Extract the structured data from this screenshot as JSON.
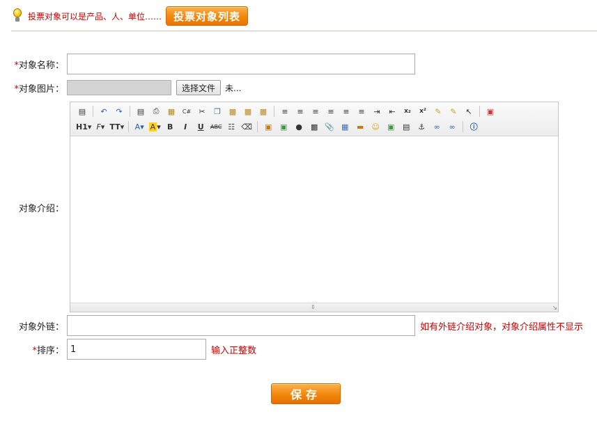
{
  "tip": {
    "text": "投票对象可以是产品、人、单位……",
    "list_button": "投票对象列表"
  },
  "form": {
    "name": {
      "required_mark": "*",
      "label": "对象名称：",
      "value": ""
    },
    "image": {
      "required_mark": "*",
      "label": "对象图片：",
      "choose_button": "选择文件",
      "status": "未..."
    },
    "intro": {
      "label": "对象介绍："
    },
    "link": {
      "label": "对象外链：",
      "value": "",
      "hint": "如有外链介绍对象，对象介绍属性不显示"
    },
    "sort": {
      "required_mark": "*",
      "label": "排序：",
      "value": "1",
      "hint": "输入正整数"
    },
    "save_button": "保存"
  },
  "editor_toolbar": {
    "row1": [
      "source",
      "undo",
      "redo",
      "preview",
      "print",
      "template",
      "code",
      "cut",
      "copy",
      "paste",
      "paste-plain",
      "paste-word",
      "select-all",
      "align-left",
      "align-center",
      "align-right",
      "justify",
      "ordered-list",
      "unordered-list",
      "indent",
      "outdent",
      "subscript",
      "superscript",
      "clear-format",
      "quick-format",
      "select",
      "fullscreen"
    ],
    "row2": {
      "heading": "H1",
      "font_family": "F",
      "font_size": "TT",
      "font_color": "A",
      "highlight": "A",
      "bold": "B",
      "italic": "I",
      "underline": "U",
      "strikethrough": "ABC",
      "hr": "",
      "tools": [
        "image",
        "multi-image",
        "flash",
        "media",
        "attachment",
        "table",
        "hr",
        "emoticons",
        "gallery",
        "pagebreak",
        "anchor",
        "link",
        "unlink",
        "help"
      ]
    }
  },
  "colors": {
    "accent_orange": "#f2870a",
    "required_red": "#cc0000"
  }
}
